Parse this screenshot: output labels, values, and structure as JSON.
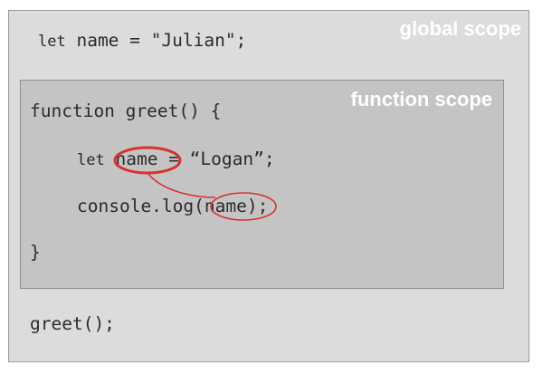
{
  "global_scope_label": "global scope",
  "function_scope_label": "function scope",
  "code": {
    "global_let_kw": "let",
    "global_decl": " name = \"Julian\";",
    "func_decl": "function greet() {",
    "inner_let_kw": "let",
    "inner_name": "name",
    "inner_rest": "= “Logan”;",
    "log_prefix": "console.log",
    "log_arg": "name",
    "log_suffix": ");",
    "close_brace": "}",
    "call": "greet();"
  },
  "colors": {
    "annotation": "#d9322e",
    "global_bg": "#dcdcdc",
    "function_bg": "#c4c4c4"
  }
}
